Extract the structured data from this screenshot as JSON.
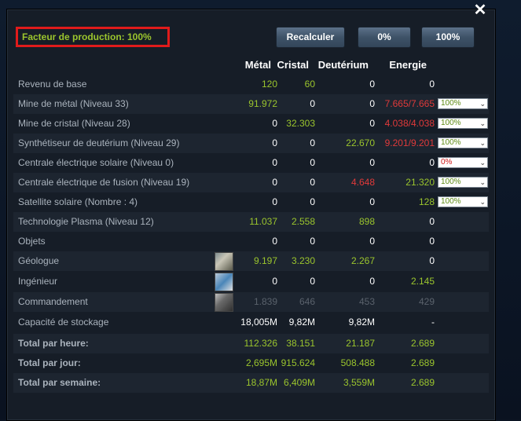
{
  "production_factor": "Facteur de production: 100%",
  "buttons": {
    "recalc": "Recalculer",
    "zero": "0%",
    "hundred": "100%"
  },
  "columns": {
    "metal": "Métal",
    "crystal": "Cristal",
    "deut": "Deutérium",
    "energy": "Energie"
  },
  "rows": [
    {
      "label": "Revenu de base",
      "m": "120",
      "c": "60",
      "d": "0",
      "e": "0"
    },
    {
      "label": "Mine de métal (Niveau 33)",
      "m": "91.972",
      "c": "0",
      "d": "0",
      "e": "7.665/7.665",
      "select": "100%"
    },
    {
      "label": "Mine de cristal (Niveau 28)",
      "m": "0",
      "c": "32.303",
      "d": "0",
      "e": "4.038/4.038",
      "select": "100%"
    },
    {
      "label": "Synthétiseur de deutérium (Niveau 29)",
      "m": "0",
      "c": "0",
      "d": "22.670",
      "e": "9.201/9.201",
      "select": "100%"
    },
    {
      "label": "Centrale électrique solaire (Niveau 0)",
      "m": "0",
      "c": "0",
      "d": "0",
      "e": "0",
      "select": "0%"
    },
    {
      "label": "Centrale électrique de fusion (Niveau 19)",
      "m": "0",
      "c": "0",
      "d": "4.648",
      "e": "21.320",
      "select": "100%"
    },
    {
      "label": "Satellite solaire (Nombre : 4)",
      "m": "0",
      "c": "0",
      "d": "0",
      "e": "128",
      "select": "100%"
    },
    {
      "label": "Technologie Plasma (Niveau 12)",
      "m": "11.037",
      "c": "2.558",
      "d": "898",
      "e": "0"
    },
    {
      "label": "Objets",
      "m": "0",
      "c": "0",
      "d": "0",
      "e": "0"
    },
    {
      "label": "Géologue",
      "m": "9.197",
      "c": "3.230",
      "d": "2.267",
      "e": "0",
      "avatar": "geologist-avatar"
    },
    {
      "label": "Ingénieur",
      "m": "0",
      "c": "0",
      "d": "0",
      "e": "2.145",
      "avatar": "engineer-avatar"
    },
    {
      "label": "Commandement",
      "m": "1.839",
      "c": "646",
      "d": "453",
      "e": "429",
      "avatar": "commander-avatar"
    },
    {
      "label": "Capacité de stockage",
      "m": "18,005M",
      "c": "9,82M",
      "d": "9,82M",
      "e": "-"
    },
    {
      "label": "Total par heure:",
      "m": "112.326",
      "c": "38.151",
      "d": "21.187",
      "e": "2.689"
    },
    {
      "label": "Total par jour:",
      "m": "2,695M",
      "c": "915.624",
      "d": "508.488",
      "e": "2.689"
    },
    {
      "label": "Total par semaine:",
      "m": "18,87M",
      "c": "6,409M",
      "d": "3,559M",
      "e": "2.689"
    }
  ],
  "colors": {
    "green": "#9bc52d",
    "red": "#e03a3a",
    "panel": "#161d27",
    "highlight_border": "#e01b1b"
  }
}
